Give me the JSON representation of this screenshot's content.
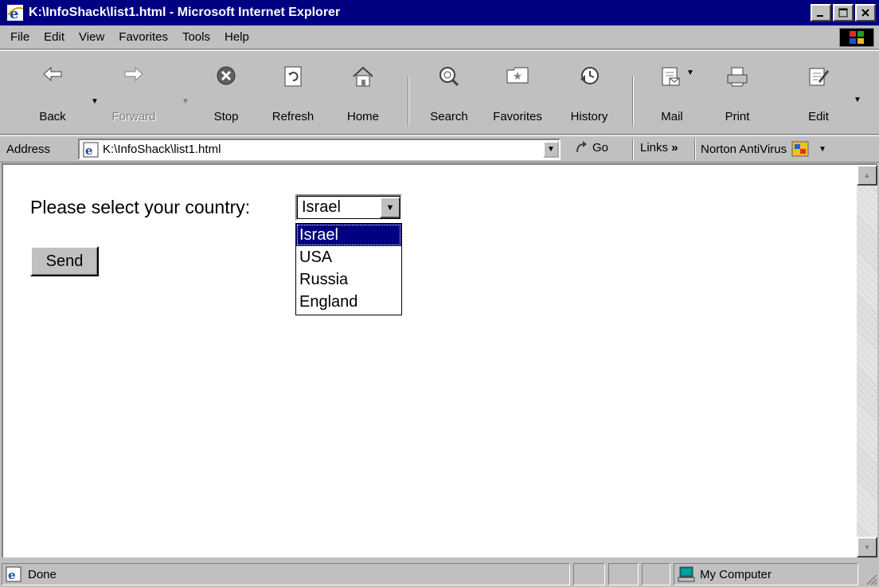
{
  "window": {
    "title": "K:\\InfoShack\\list1.html - Microsoft Internet Explorer",
    "minimize_icon": "minimize-icon",
    "maximize_icon": "maximize-icon",
    "close_icon": "close-icon"
  },
  "menu": {
    "file": "File",
    "edit": "Edit",
    "view": "View",
    "favorites": "Favorites",
    "tools": "Tools",
    "help": "Help"
  },
  "toolbar": {
    "back": "Back",
    "forward": "Forward",
    "stop": "Stop",
    "refresh": "Refresh",
    "home": "Home",
    "search": "Search",
    "favorites": "Favorites",
    "history": "History",
    "mail": "Mail",
    "print": "Print",
    "edit": "Edit"
  },
  "address": {
    "label": "Address",
    "value": "K:\\InfoShack\\list1.html",
    "go": "Go",
    "links": "Links",
    "links_chevron": "»",
    "norton": "Norton AntiVirus"
  },
  "page": {
    "prompt": "Please select your country:",
    "select_value": "Israel",
    "options": [
      "Israel",
      "USA",
      "Russia",
      "England"
    ],
    "selected_option": "Israel",
    "send_button": "Send"
  },
  "status": {
    "text": "Done",
    "zone": "My Computer"
  },
  "colors": {
    "titlebar": "#000080",
    "chrome": "#c0c0c0",
    "selection": "#000080"
  }
}
